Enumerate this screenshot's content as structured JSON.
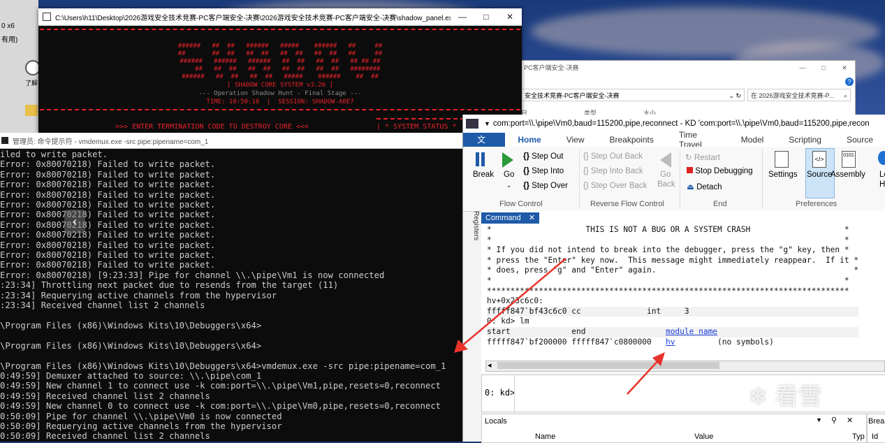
{
  "desktop": {
    "left_icon_text1": "0 x6",
    "left_icon_text2": "有用)",
    "left_icon_text3": "了解"
  },
  "shadow_panel": {
    "title": "C:\\Users\\h11\\Desktop\\2026游戏安全技术竞赛-PC客户端安全-决赛\\2026游戏安全技术竞赛-PC客户端安全-决赛\\shadow_panel.exe",
    "banner": [
      "######   ##  ##   ######   #####    ######   ##     ##",
      "##       ##  ##   ##  ##   ##  ##   ##  ##   ##     ##",
      "######   ######   ######   ##  ##   ##  ##   ## ## ##",
      "    ##   ##  ##   ##  ##   ##  ##   ##  ##   ########",
      "######   ##  ##   ##  ##   #####    ######    ##  ##"
    ],
    "system_name": "[ SHADOW CORE SYSTEM v3.26 ]",
    "operation": "--- Operation Shadow Hunt - Final Stage ---",
    "time_session": "TIME: 10:50:18  |  SESSION: SHADOW-A0E7",
    "prompt": ">>> ENTER TERMINATION CODE TO DESTROY CORE <<<",
    "status": "| * SYSTEM STATUS *"
  },
  "explorer": {
    "title": "PC客户端安全-决赛",
    "path": "安全技术竞赛-PC客户端安全-决赛",
    "search_placeholder": "在 2026游戏安全技术竞赛-P...",
    "col_date": "日期",
    "col_type": "类型",
    "col_size": "大小"
  },
  "cmd": {
    "title": "管理员: 命令提示符 - vmdemux.exe  -src pipe:pipename=com_1",
    "lines": [
      "iled to write packet.",
      "Error: 0x80070218) Failed to write packet.",
      "Error: 0x80070218) Failed to write packet.",
      "Error: 0x80070218) Failed to write packet.",
      "Error: 0x80070218) Failed to write packet.",
      "Error: 0x80070218) Failed to write packet.",
      "Error: 0x80070218) Failed to write packet.",
      "Error: 0x80070218) Failed to write packet.",
      "Error: 0x80070218) Failed to write packet.",
      "Error: 0x80070218) Failed to write packet.",
      "Error: 0x80070218) Failed to write packet.",
      "Error: 0x80070218) Failed to write packet.",
      "Error: 0x80070218) [9:23:33] Pipe for channel \\\\.\\pipe\\Vm1 is now connected",
      ":23:34] Throttling next packet due to resends from the target (11)",
      ":23:34] Requerying active channels from the hypervisor",
      ":23:34] Received channel list 2 channels",
      "",
      "\\Program Files (x86)\\Windows Kits\\10\\Debuggers\\x64>",
      "",
      "\\Program Files (x86)\\Windows Kits\\10\\Debuggers\\x64>",
      "",
      "\\Program Files (x86)\\Windows Kits\\10\\Debuggers\\x64>vmdemux.exe -src pipe:pipename=com_1",
      "0:49:59] Demuxer attached to source: \\\\.\\pipe\\com_1",
      "0:49:59] New channel 1 to connect use -k com:port=\\\\.\\pipe\\Vm1,pipe,resets=0,reconnect",
      "0:49:59] Received channel list 2 channels",
      "0:49:59] New channel 0 to connect use -k com:port=\\\\.\\pipe\\Vm0,pipe,resets=0,reconnect",
      "0:50:09] Pipe for channel \\\\.\\pipe\\Vm0 is now connected",
      "0:50:09] Requerying active channels from the hypervisor",
      "0:50:09] Received channel list 2 channels"
    ]
  },
  "windbg": {
    "title": "com:port=\\\\.\\pipe\\Vm0,baud=115200,pipe,reconnect - KD 'com:port=\\\\.\\pipe\\Vm0,baud=115200,pipe,recon",
    "tabs": [
      "文件",
      "Home",
      "View",
      "Breakpoints",
      "Time Travel",
      "Model",
      "Scripting",
      "Source"
    ],
    "ribbon": {
      "break": "Break",
      "go": "Go",
      "step_out": "Step Out",
      "step_into": "Step Into",
      "step_over": "Step Over",
      "step_out_back": "Step Out Back",
      "step_into_back": "Step Into Back",
      "step_over_back": "Step Over Back",
      "go_back_1": "Go",
      "go_back_2": "Back",
      "restart": "Restart",
      "stop_debugging": "Stop Debugging",
      "detach": "Detach",
      "settings": "Settings",
      "source": "Source",
      "assembly": "Assembly",
      "local_1": "Lo",
      "local_2": "He",
      "group_flow": "Flow Control",
      "group_reverse": "Reverse Flow Control",
      "group_end": "End",
      "group_prefs": "Preferences"
    },
    "registers_label": "Registers",
    "command_tab": "Command",
    "command_lines": [
      "*                    THIS IS NOT A BUG OR A SYSTEM CRASH                    *",
      "*                                                                           *",
      "* If you did not intend to break into the debugger, press the \"g\" key, then *",
      "* press the \"Enter\" key now.  This message might immediately reappear.  If it *",
      "* does, press \"g\" and \"Enter\" again.                                          *",
      "*                                                                           *",
      "*****************************************************************************",
      "hv+0x23c6c0:",
      "fffff847`bf43c6c0 cc              int     3",
      "0: kd> lm",
      "start             end                 "
    ],
    "module_header_link": "module name",
    "module_line_prefix": "fffff847`bf200000 fffff847`c0800000   ",
    "module_link": "hv",
    "module_suffix": "         (no symbols)",
    "prompt": "0: kd>",
    "locals_title": "Locals",
    "locals_col_name": "Name",
    "locals_col_value": "Value",
    "locals_col_type": "Typ",
    "break_panel": "Breal",
    "break_col": "Id"
  },
  "watermark": "看雪"
}
